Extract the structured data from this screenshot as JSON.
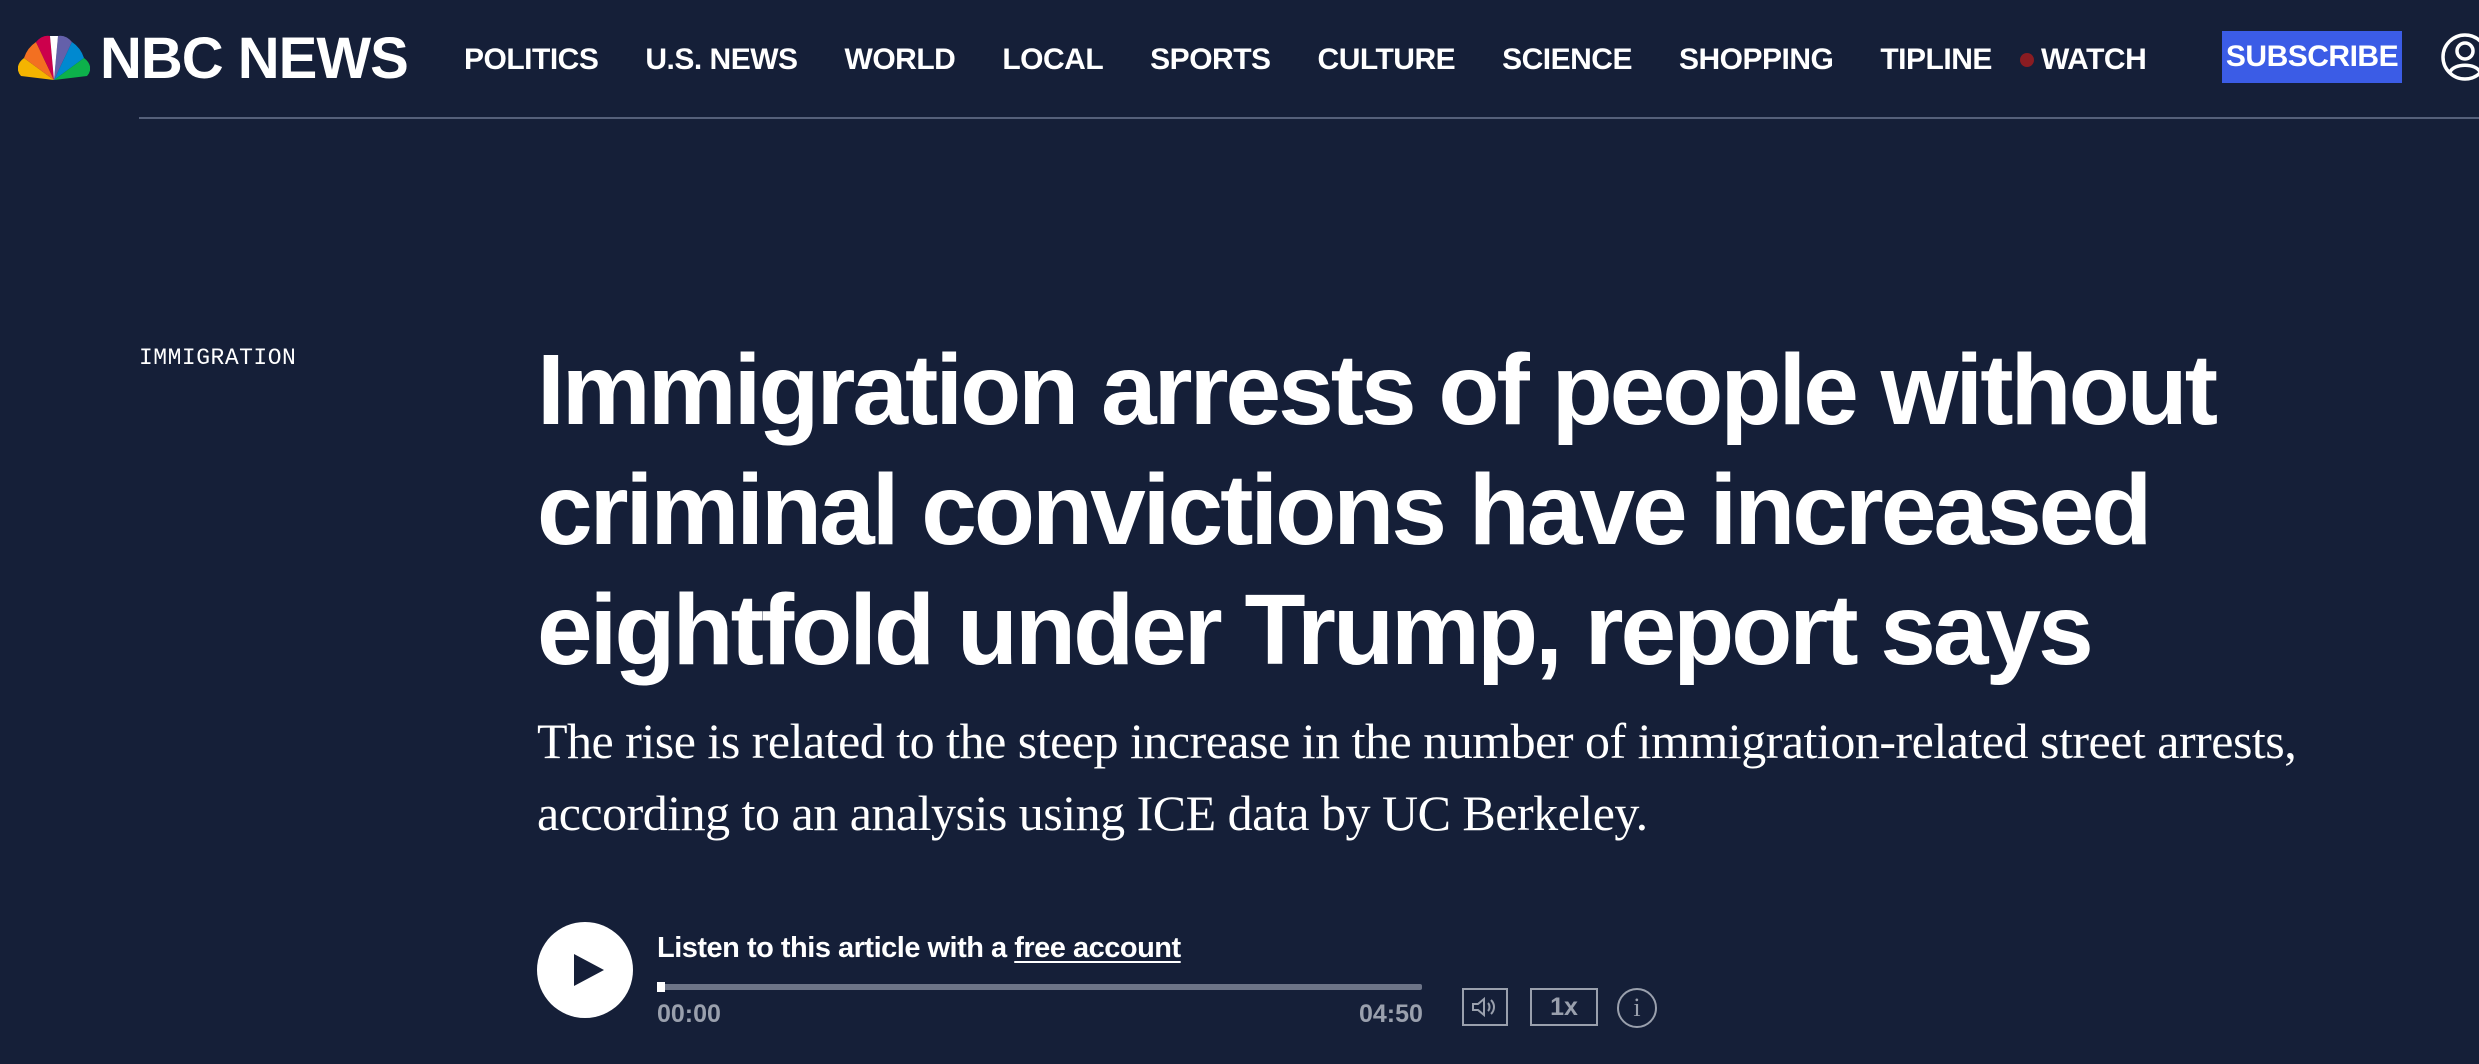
{
  "site": {
    "logo_text": "NBC NEWS",
    "logo_icon": "nbc-peacock-icon"
  },
  "nav": {
    "items": [
      {
        "label": "POLITICS"
      },
      {
        "label": "U.S. NEWS"
      },
      {
        "label": "WORLD"
      },
      {
        "label": "LOCAL"
      },
      {
        "label": "SPORTS"
      },
      {
        "label": "CULTURE"
      },
      {
        "label": "SCIENCE"
      },
      {
        "label": "SHOPPING"
      },
      {
        "label": "TIPLINE"
      }
    ],
    "watch_label": "WATCH",
    "subscribe_label": "SUBSCRIBE",
    "account_icon": "account-icon"
  },
  "article": {
    "section": "IMMIGRATION",
    "headline": "Immigration arrests of people without criminal convictions have increased eightfold under Trump, report says",
    "dek": "The rise is related to the steep increase in the number of immigration-related street arrests, according to an analysis using ICE data by UC Berkeley."
  },
  "audio": {
    "listen_prefix": "Listen to this article with a ",
    "listen_link": "free account",
    "time_current": "00:00",
    "time_total": "04:50",
    "progress_fraction": 0,
    "speed": "1x",
    "info_symbol": "i"
  },
  "colors": {
    "background": "#151f38",
    "subscribe": "#3b5ce6",
    "live_dot": "#8a1c22",
    "muted_text": "#9aa0ad"
  }
}
